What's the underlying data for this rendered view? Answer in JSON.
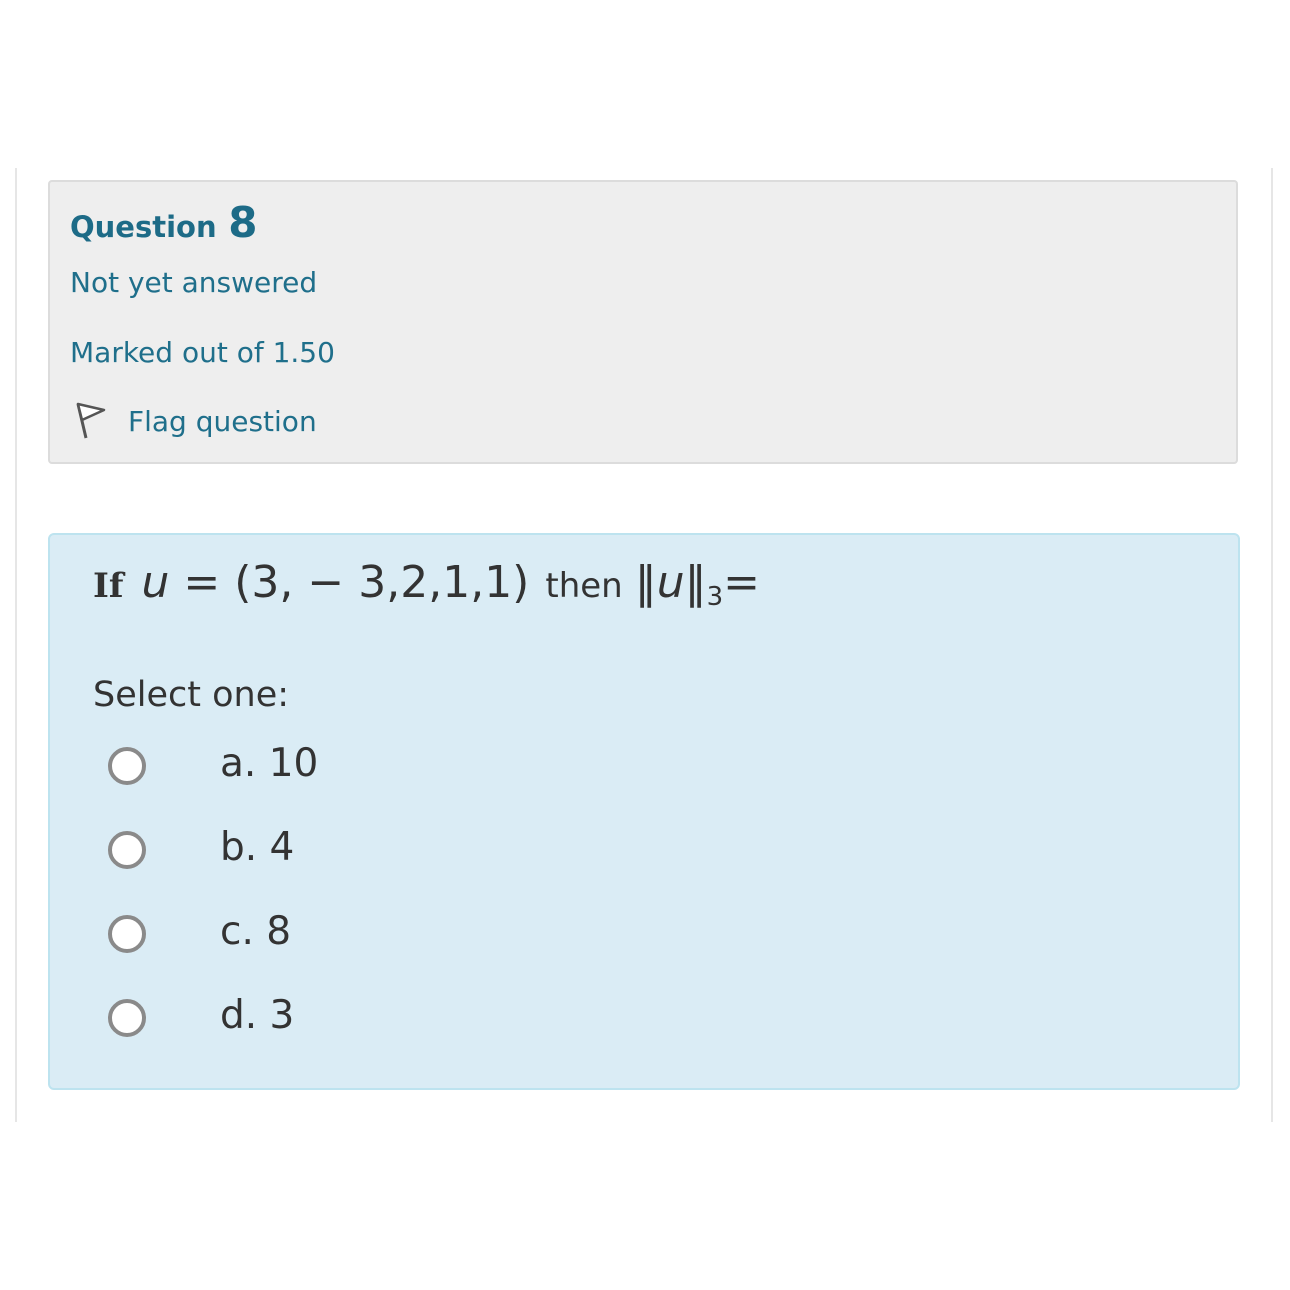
{
  "question": {
    "title_word": "Question",
    "number": "8",
    "state": "Not yet answered",
    "grade": "Marked out of 1.50",
    "flag_label": "Flag question",
    "flag_icon": "flag-icon"
  },
  "content": {
    "prefix": "If",
    "math_lhs_var": "u",
    "math_rhs": " = (3, − 3,2,1,1)",
    "middle": "then",
    "norm_open": "‖",
    "norm_var": "u",
    "norm_close": "‖",
    "norm_sub": "3",
    "norm_eq": "=",
    "select_label": "Select one:",
    "answers": [
      {
        "label": "a. 10"
      },
      {
        "label": "b. 4"
      },
      {
        "label": "c. 8"
      },
      {
        "label": "d. 3"
      }
    ]
  },
  "colors": {
    "accent": "#1d6b87",
    "info_bg": "#eeeeee",
    "content_bg": "#daecf5",
    "content_border": "#bde3ef",
    "text": "#333333"
  }
}
